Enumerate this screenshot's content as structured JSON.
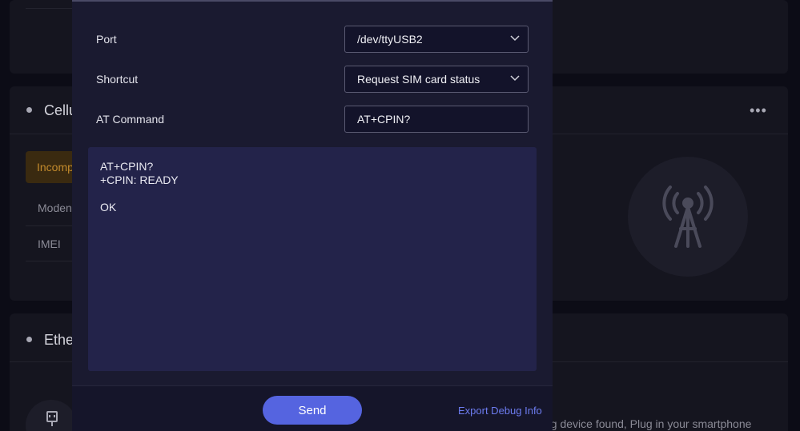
{
  "background": {
    "cellular_title": "Cellu",
    "cellular_badge": "Incomp",
    "modem_label": "Moden",
    "imei_label": "IMEI",
    "ethernet_title": "Ethe",
    "ethernet_message": "ng device found, Plug in your smartphone",
    "more_icon": "more-horizontal-icon",
    "tower_icon": "cell-tower-icon",
    "usb_icon": "usb-plug-icon"
  },
  "modal": {
    "port_label": "Port",
    "port_value": "/dev/ttyUSB2",
    "shortcut_label": "Shortcut",
    "shortcut_value": "Request SIM card status",
    "at_command_label": "AT Command",
    "at_command_value": "AT+CPIN?",
    "output_lines": [
      "AT+CPIN?",
      "+CPIN: READY",
      "",
      "OK"
    ],
    "send_label": "Send",
    "export_label": "Export Debug Info"
  },
  "colors": {
    "accent": "#5564e0",
    "link": "#6d7cf0",
    "warning": "#c28a2c"
  }
}
